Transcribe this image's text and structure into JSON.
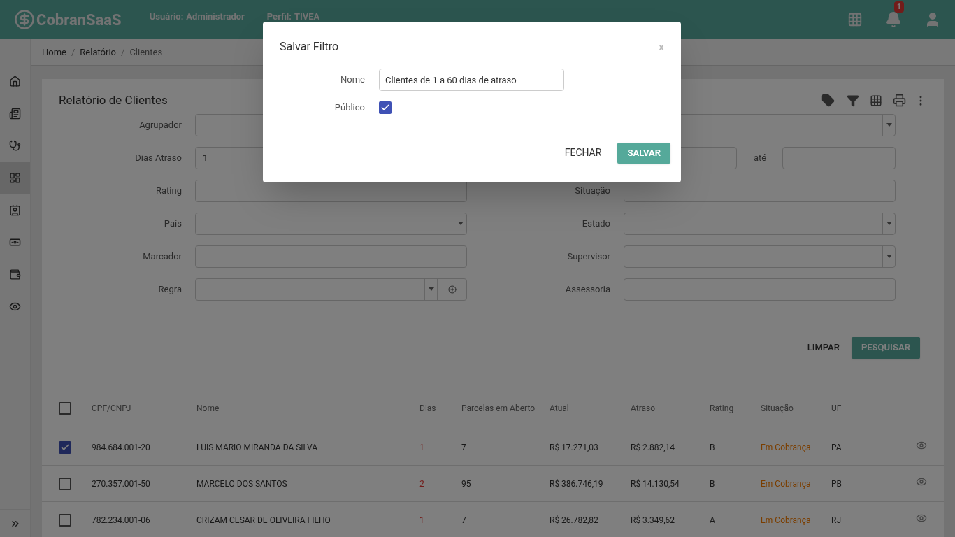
{
  "header": {
    "logo": "CobranSaaS",
    "user_label": "Usuário:",
    "user_value": "Administrador",
    "profile_label": "Perfil:",
    "profile_value": "TIVEA",
    "notification_count": "1"
  },
  "sidebar": {
    "items": [
      {
        "selected": false
      },
      {
        "selected": false
      },
      {
        "selected": false
      },
      {
        "selected": true
      },
      {
        "selected": false
      },
      {
        "selected": false
      },
      {
        "selected": false
      },
      {
        "selected": false
      }
    ]
  },
  "breadcrumb": {
    "separator": "/",
    "items": [
      "Home",
      "Relatório",
      "Clientes"
    ]
  },
  "card": {
    "title": "Relatório de Clientes"
  },
  "form": {
    "agrupador": {
      "label": "Agrupador"
    },
    "dias_atraso": {
      "label": "Dias Atraso",
      "value": "1",
      "range_label": "até"
    },
    "rows": [
      {
        "left": {
          "label": "Rating",
          "kind": "text"
        },
        "right": {
          "label": "Situação",
          "kind": "text"
        }
      },
      {
        "left": {
          "label": "País",
          "kind": "select"
        },
        "right": {
          "label": "Estado",
          "kind": "select"
        }
      },
      {
        "left": {
          "label": "Marcador",
          "kind": "text"
        },
        "right": {
          "label": "Supervisor",
          "kind": "select"
        }
      },
      {
        "left": {
          "label": "Regra",
          "kind": "select-add"
        },
        "right": {
          "label": "Assessoria",
          "kind": "text"
        }
      }
    ],
    "buttons": {
      "clear": "LIMPAR",
      "search": "PESQUISAR"
    }
  },
  "table": {
    "select_all": false,
    "columns": [
      "CPF/CNPJ",
      "Nome",
      "Dias",
      "Parcelas em Aberto",
      "Atual",
      "Atraso",
      "Rating",
      "Situação",
      "UF"
    ],
    "rows": [
      {
        "checked": true,
        "cells": [
          "984.684.001-20",
          "LUIS MARIO MIRANDA DA SILVA",
          "1",
          "7",
          "R$ 17.271,03",
          "R$ 2.882,14",
          "B",
          "Em Cobrança",
          "PA"
        ]
      },
      {
        "checked": false,
        "cells": [
          "270.357.001-50",
          "MARCELO DOS SANTOS",
          "2",
          "95",
          "R$ 386.746,19",
          "R$ 14.130,54",
          "B",
          "Em Cobrança",
          "PB"
        ]
      },
      {
        "checked": false,
        "cells": [
          "782.234.001-06",
          "CRIZAM CESAR DE OLIVEIRA FILHO",
          "1",
          "7",
          "R$ 26.782,82",
          "R$ 3.349,62",
          "A",
          "Em Cobrança",
          "RJ"
        ]
      }
    ]
  },
  "dialog": {
    "title": "Salvar Filtro",
    "close": "x",
    "name_label": "Nome",
    "name_value": "Clientes de 1 a 60 dias de atraso",
    "public_label": "Público",
    "public_checked": true,
    "cancel": "FECHAR",
    "save": "SALVAR"
  }
}
